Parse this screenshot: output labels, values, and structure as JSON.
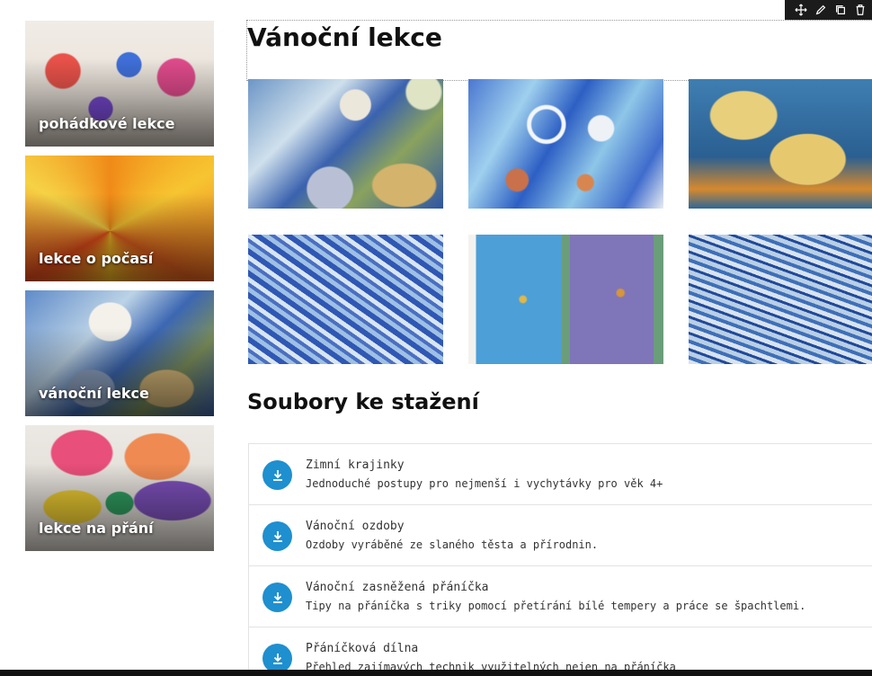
{
  "sidebar": {
    "tiles": [
      {
        "label": "pohádkové lekce"
      },
      {
        "label": "lekce o počasí"
      },
      {
        "label": "vánoční lekce"
      },
      {
        "label": "lekce na přání"
      }
    ]
  },
  "toolbar": {
    "icons": [
      "move-icon",
      "edit-icon",
      "duplicate-icon",
      "delete-icon"
    ]
  },
  "main": {
    "title": "Vánoční lekce",
    "downloads_title": "Soubory ke stažení",
    "downloads": [
      {
        "title": "Zimní krajinky",
        "desc": "Jednoduché postupy pro nejmenší i vychytávky pro věk 4+"
      },
      {
        "title": "Vánoční ozdoby",
        "desc": "Ozdoby vyráběné ze slaného těsta a přírodnin."
      },
      {
        "title": "Vánoční zasněžená přáníčka",
        "desc": "Tipy na přáníčka s triky pomocí přetírání bílé tempery a práce se špachtlemi."
      },
      {
        "title": "Přáníčková dílna",
        "desc": "Přehled zajímavých technik využitelných nejen na přáníčka"
      }
    ]
  },
  "colors": {
    "accent": "#1e8fcf",
    "toolbar_bg": "#1b1b1b"
  }
}
